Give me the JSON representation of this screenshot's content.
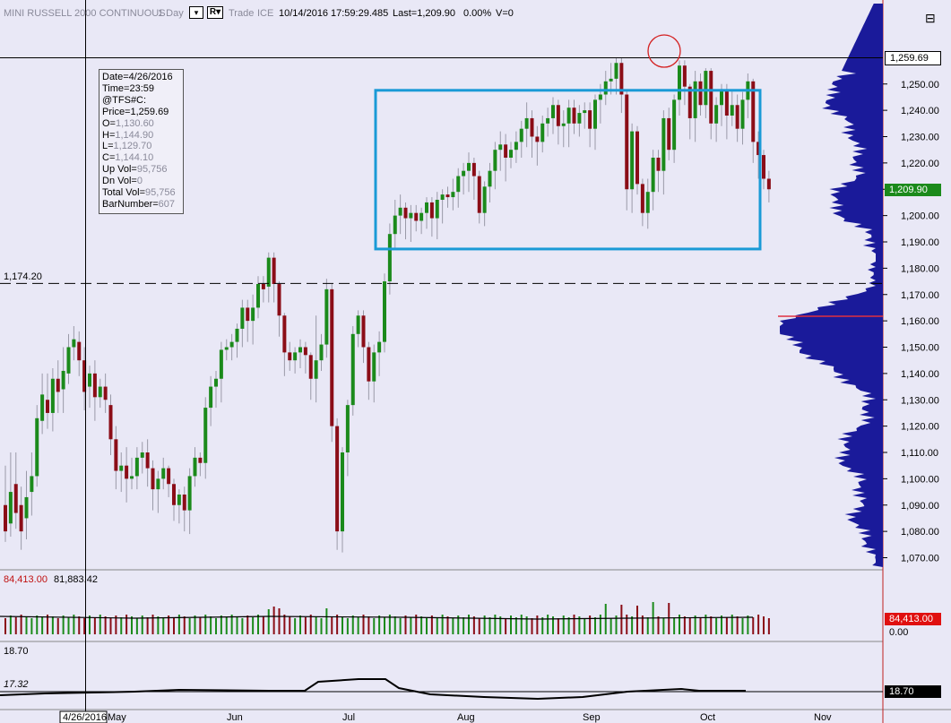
{
  "header": {
    "symbol": "MINI RUSSELL 2000 CONTINUOUS",
    "interval": "1 Day",
    "interval_dropdown": "▾",
    "r_button": "R▾",
    "trade": "Trade",
    "exchange": "ICE",
    "date": "10/14/2016",
    "time": "17:59:29.485",
    "last": "Last=1,209.90",
    "change": "0.00%",
    "volume": "V=0",
    "menu_icon": "⊟"
  },
  "info_box": {
    "date": "Date=4/26/2016",
    "time": "Time=23:59",
    "symbol": "@TFS#C:",
    "price": "Price=1,259.69",
    "open_label": "O=",
    "open_value": "1,130.60",
    "high_label": "H=",
    "high_value": "1,144.90",
    "low_label": "L=",
    "low_value": "1,129.70",
    "close_label": "C=",
    "close_value": "1,144.10",
    "upvol_label": "Up Vol=",
    "upvol_value": "95,756",
    "dnvol_label": "Dn Vol=",
    "dnvol_value": "0",
    "totvol_label": "Total Vol=",
    "totvol_value": "95,756",
    "bar_label": "BarNumber=",
    "bar_value": "607"
  },
  "price_panel": {
    "dashed_level_label": "1,174.20",
    "crosshair_price_tag": "1,259.69",
    "last_price_tag": "1,209.90",
    "last_price_tag_color": "#1b8a1b"
  },
  "volume_panel": {
    "header_value_red": "84,413.00",
    "header_value_black": "81,883.42",
    "tag_red": "84,413.00",
    "tag_zero": "0.00"
  },
  "indicator_panel": {
    "header_value": "18.70",
    "line_label": "17.32",
    "tag": "18.70"
  },
  "colors": {
    "background": "#e9e8f6",
    "up_bar": "#1b8a1b",
    "down_bar": "#8b0d17",
    "rectangle": "#1a9ad6",
    "profile": "#1a1a9a",
    "circle": "#d42020"
  },
  "chart_data": {
    "type": "candlestick",
    "title": "MINI RUSSELL 2000 CONTINUOUS",
    "x_ticks": [
      "4/26/2016",
      "May",
      "Jun",
      "Jul",
      "Aug",
      "Sep",
      "Oct",
      "Nov"
    ],
    "y_ticks": [
      "1,070.00",
      "1,080.00",
      "1,090.00",
      "1,100.00",
      "1,110.00",
      "1,120.00",
      "1,130.00",
      "1,140.00",
      "1,150.00",
      "1,160.00",
      "1,170.00",
      "1,180.00",
      "1,190.00",
      "1,200.00",
      "1,210.00",
      "1,220.00",
      "1,230.00",
      "1,240.00",
      "1,250.00"
    ],
    "y_range": [
      1066.5,
      1251.2
    ],
    "price_series": [
      [
        1090,
        1080,
        1105
      ],
      [
        1083,
        1095,
        1110
      ],
      [
        1098,
        1087,
        1110
      ],
      [
        1090,
        1080,
        1097
      ],
      [
        1085,
        1093,
        1103
      ],
      [
        1095,
        1101,
        1110
      ],
      [
        1101,
        1123,
        1128
      ],
      [
        1122,
        1132,
        1140
      ],
      [
        1130,
        1125,
        1140
      ],
      [
        1125,
        1138,
        1142
      ],
      [
        1138,
        1133,
        1145
      ],
      [
        1134,
        1141,
        1150
      ],
      [
        1140,
        1150,
        1155
      ],
      [
        1150,
        1153,
        1158
      ],
      [
        1152,
        1145,
        1156
      ],
      [
        1145,
        1133,
        1150
      ],
      [
        1135,
        1140,
        1143
      ],
      [
        1140,
        1131,
        1145
      ],
      [
        1131,
        1135,
        1138
      ],
      [
        1135,
        1130,
        1140
      ],
      [
        1128,
        1115,
        1132
      ],
      [
        1115,
        1103,
        1120
      ],
      [
        1103,
        1105,
        1110
      ],
      [
        1105,
        1100,
        1112
      ],
      [
        1100,
        1101,
        1108
      ],
      [
        1101,
        1108,
        1112
      ],
      [
        1108,
        1110,
        1114
      ],
      [
        1110,
        1104,
        1115
      ],
      [
        1104,
        1096,
        1107
      ],
      [
        1096,
        1100,
        1103
      ],
      [
        1100,
        1104,
        1108
      ],
      [
        1104,
        1098,
        1105
      ],
      [
        1098,
        1090,
        1100
      ],
      [
        1090,
        1094,
        1096
      ],
      [
        1094,
        1088,
        1097
      ],
      [
        1088,
        1101,
        1104
      ],
      [
        1101,
        1108,
        1112
      ],
      [
        1108,
        1106,
        1110
      ],
      [
        1106,
        1127,
        1131
      ],
      [
        1127,
        1135,
        1139
      ],
      [
        1135,
        1138,
        1141
      ],
      [
        1138,
        1149,
        1152
      ],
      [
        1149,
        1150,
        1153
      ],
      [
        1150,
        1152,
        1155
      ],
      [
        1152,
        1157,
        1159
      ],
      [
        1157,
        1165,
        1168
      ],
      [
        1165,
        1160,
        1168
      ],
      [
        1160,
        1165,
        1170
      ],
      [
        1165,
        1174,
        1177
      ],
      [
        1174,
        1172,
        1177
      ],
      [
        1173,
        1184,
        1186
      ],
      [
        1184,
        1174,
        1186
      ],
      [
        1174,
        1162,
        1175
      ],
      [
        1162,
        1148,
        1163
      ],
      [
        1148,
        1145,
        1152
      ],
      [
        1145,
        1148,
        1150
      ],
      [
        1148,
        1150,
        1153
      ],
      [
        1150,
        1147,
        1152
      ],
      [
        1147,
        1138,
        1148
      ],
      [
        1138,
        1145,
        1162
      ],
      [
        1145,
        1151,
        1155
      ],
      [
        1151,
        1172,
        1176
      ],
      [
        1172,
        1120,
        1174
      ],
      [
        1120,
        1080,
        1123
      ],
      [
        1080,
        1110,
        1112
      ],
      [
        1110,
        1128,
        1130
      ],
      [
        1128,
        1155,
        1158
      ],
      [
        1155,
        1162,
        1164
      ],
      [
        1162,
        1150,
        1164
      ],
      [
        1150,
        1137,
        1152
      ],
      [
        1137,
        1148,
        1151
      ],
      [
        1148,
        1152,
        1156
      ],
      [
        1152,
        1175,
        1178
      ],
      [
        1175,
        1193,
        1197
      ],
      [
        1193,
        1200,
        1206
      ],
      [
        1200,
        1203,
        1208
      ],
      [
        1203,
        1199,
        1205
      ],
      [
        1199,
        1201,
        1204
      ],
      [
        1201,
        1198,
        1204
      ],
      [
        1198,
        1201,
        1203
      ],
      [
        1201,
        1205,
        1207
      ],
      [
        1205,
        1199,
        1207
      ],
      [
        1199,
        1206,
        1209
      ],
      [
        1206,
        1208,
        1210
      ],
      [
        1208,
        1207,
        1211
      ],
      [
        1207,
        1209,
        1214
      ],
      [
        1209,
        1215,
        1218
      ],
      [
        1215,
        1217,
        1220
      ],
      [
        1217,
        1220,
        1224
      ],
      [
        1220,
        1215,
        1222
      ],
      [
        1215,
        1201,
        1217
      ],
      [
        1201,
        1211,
        1213
      ],
      [
        1211,
        1217,
        1220
      ],
      [
        1217,
        1225,
        1228
      ],
      [
        1225,
        1227,
        1232
      ],
      [
        1227,
        1222,
        1231
      ],
      [
        1222,
        1225,
        1228
      ],
      [
        1225,
        1228,
        1232
      ],
      [
        1228,
        1233,
        1236
      ],
      [
        1233,
        1237,
        1243
      ],
      [
        1237,
        1230,
        1240
      ],
      [
        1230,
        1228,
        1234
      ],
      [
        1228,
        1235,
        1238
      ],
      [
        1235,
        1237,
        1241
      ],
      [
        1237,
        1242,
        1245
      ],
      [
        1242,
        1234,
        1244
      ],
      [
        1234,
        1235,
        1240
      ],
      [
        1235,
        1241,
        1244
      ],
      [
        1241,
        1235,
        1244
      ],
      [
        1235,
        1239,
        1242
      ],
      [
        1239,
        1240,
        1243
      ],
      [
        1240,
        1233,
        1243
      ],
      [
        1233,
        1244,
        1246
      ],
      [
        1244,
        1246,
        1250
      ],
      [
        1246,
        1251,
        1255
      ],
      [
        1251,
        1252,
        1258
      ],
      [
        1252,
        1258,
        1260
      ],
      [
        1258,
        1246,
        1260
      ],
      [
        1246,
        1210,
        1248
      ],
      [
        1210,
        1232,
        1235
      ],
      [
        1232,
        1212,
        1234
      ],
      [
        1212,
        1201,
        1214
      ],
      [
        1201,
        1209,
        1214
      ],
      [
        1209,
        1222,
        1225
      ],
      [
        1222,
        1217,
        1225
      ],
      [
        1217,
        1237,
        1240
      ],
      [
        1237,
        1225,
        1241
      ],
      [
        1225,
        1244,
        1246
      ],
      [
        1244,
        1257,
        1259
      ],
      [
        1257,
        1249,
        1259
      ],
      [
        1249,
        1237,
        1250
      ],
      [
        1237,
        1251,
        1255
      ],
      [
        1251,
        1242,
        1254
      ],
      [
        1242,
        1255,
        1256
      ],
      [
        1255,
        1235,
        1256
      ],
      [
        1235,
        1242,
        1245
      ],
      [
        1242,
        1248,
        1250
      ],
      [
        1248,
        1238,
        1250
      ],
      [
        1238,
        1242,
        1248
      ],
      [
        1242,
        1233,
        1246
      ],
      [
        1233,
        1244,
        1247
      ],
      [
        1244,
        1251,
        1254
      ],
      [
        1251,
        1228,
        1252
      ],
      [
        1228,
        1223,
        1232
      ],
      [
        1223,
        1214,
        1225
      ],
      [
        1214,
        1210,
        1217
      ]
    ],
    "ohlc_format": [
      "open",
      "close",
      "high"
    ],
    "horizontal_level": 1174.2,
    "rectangle_range": [
      1187.3,
      1247.6
    ],
    "volume_axis_labels": [
      "84,413.00",
      "0.00"
    ],
    "indicator_axis_label": "18.70"
  }
}
